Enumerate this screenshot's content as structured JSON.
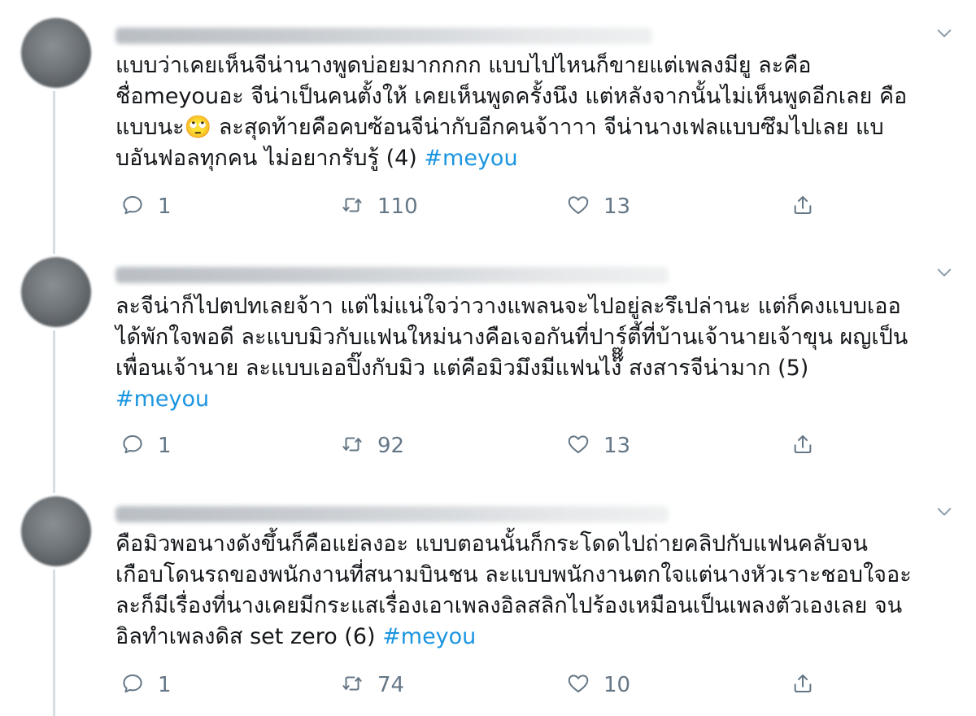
{
  "tweets": [
    {
      "text": "แบบว่าเคยเห็นจีน่านางพูดบ่อยมากกกก แบบไปไหนก็ขายแต่เพลงมียู ละคือ\nชื่อmeyouอะ จีน่าเป็นคนตั้งให้ เคยเห็นพูดครั้งนึง แต่หลังจากนั้นไม่เห็นพูดอีกเลย คือ\nแบบนะ🙄 ละสุดท้ายคือคบซ้อนจีน่ากับอีกคนจ้าาาา จีน่านางเฟลแบบซึมไปเลย แบ\nบอันฟอลทุกคน ไม่อยากรับรู้ (4) ",
      "hashtag": "#meyou",
      "replies": "1",
      "retweets": "110",
      "likes": "13"
    },
    {
      "text": "ละจีน่าก็ไปตปทเลยจ้าา แต่ไม่แน่ใจว่าวางแพลนจะไปอยู่ละรึเปล่านะ แต่ก็คงแบบเออ\nได้พักใจพอดี ละแบบมิวกับแฟนใหม่นางคือเจอกันที่ปาร์ตี้ที่บ้านเจ้านายเจ้าขุน ผญเป็น\nเพื่อนเจ้านาย ละแบบเออปิ๊งกับมิว แต่คือมิวมึงมีแฟนไง๊๊๊ สงสารจีน่ามาก (5)\n",
      "hashtag": "#meyou",
      "replies": "1",
      "retweets": "92",
      "likes": "13"
    },
    {
      "text": "คือมิวพอนางดังขึ้นก็คือแย่ลงอะ แบบตอนนั้นก็กระโดดไปถ่ายคลิปกับแฟนคลับจน\nเกือบโดนรถของพนักงานที่สนามบินชน ละแบบพนักงานตกใจแต่นางหัวเราะชอบใจอะ\nละก็มีเรื่องที่นางเคยมีกระแสเรื่องเอาเพลงอิลสลิกไปร้องเหมือนเป็นเพลงตัวเองเลย จน\nอิลทำเพลงดิส set zero (6) ",
      "hashtag": "#meyou",
      "replies": "1",
      "retweets": "74",
      "likes": "10"
    }
  ],
  "icons": {
    "reply": "reply-icon",
    "retweet": "retweet-icon",
    "like": "heart-icon",
    "share": "share-icon",
    "more": "chevron-down-icon"
  },
  "colors": {
    "text": "#14171a",
    "muted": "#657786",
    "hashtag": "#1b95e0",
    "thread_line": "#d6dde3"
  }
}
